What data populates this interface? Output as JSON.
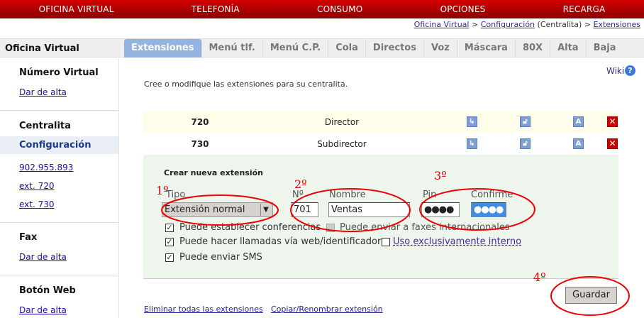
{
  "topnav": [
    "OFICINA VIRTUAL",
    "TELEFONÍA",
    "CONSUMO",
    "OPCIONES",
    "RECARGA"
  ],
  "breadcrumb": {
    "items": [
      "Oficina Virtual",
      "Configuración",
      "Extensiones"
    ],
    "sep": ">",
    "note": "(Centralita)"
  },
  "sidebar": {
    "title": "Oficina Virtual",
    "sections": [
      {
        "heading": "Número Virtual",
        "links": [
          "Dar de alta"
        ]
      },
      {
        "heading": "Centralita",
        "active": "Configuración",
        "links": [
          "902.955.893",
          "ext. 720",
          "ext. 730"
        ]
      },
      {
        "heading": "Fax",
        "links": [
          "Dar de alta"
        ]
      },
      {
        "heading": "Botón Web",
        "links": [
          "Dar de alta"
        ]
      }
    ]
  },
  "tabs": [
    "Extensiones",
    "Menú tlf.",
    "Menú C.P.",
    "Cola",
    "Directos",
    "Voz",
    "Máscara",
    "80X",
    "Alta",
    "Baja"
  ],
  "wiki": "Wiki",
  "intro": "Cree o modifique las extensiones para su centralita.",
  "extensions": [
    {
      "number": "720",
      "name": "Director"
    },
    {
      "number": "730",
      "name": "Subdirector"
    }
  ],
  "form": {
    "title": "Crear nueva extensión",
    "tipo_label": "Tipo",
    "tipo_value": "Extensión normal",
    "num_label": "Nº",
    "num_value": "701",
    "nombre_label": "Nombre",
    "nombre_value": "Ventas",
    "pin_label": "Pin",
    "pin_value": "●●●●",
    "confirm_label": "Confirme",
    "confirm_value": "●●●●",
    "opt_conf": "Puede establecer conferencias",
    "opt_fax": "Puede enviar a faxes internacionales",
    "opt_web": "Puede hacer llamadas vía web/identificador",
    "opt_int": "Uso exclusivamente interno",
    "opt_sms": "Puede enviar SMS",
    "save": "Guardar"
  },
  "bottom_links": [
    "Eliminar todas las extensiones",
    "Copiar/Renombrar extensión"
  ],
  "annotations": [
    "1º",
    "2º",
    "3º",
    "4º"
  ],
  "colors": {
    "topbar": "#c00000",
    "active_tab": "#94b4df",
    "annotation": "#dd0000"
  }
}
